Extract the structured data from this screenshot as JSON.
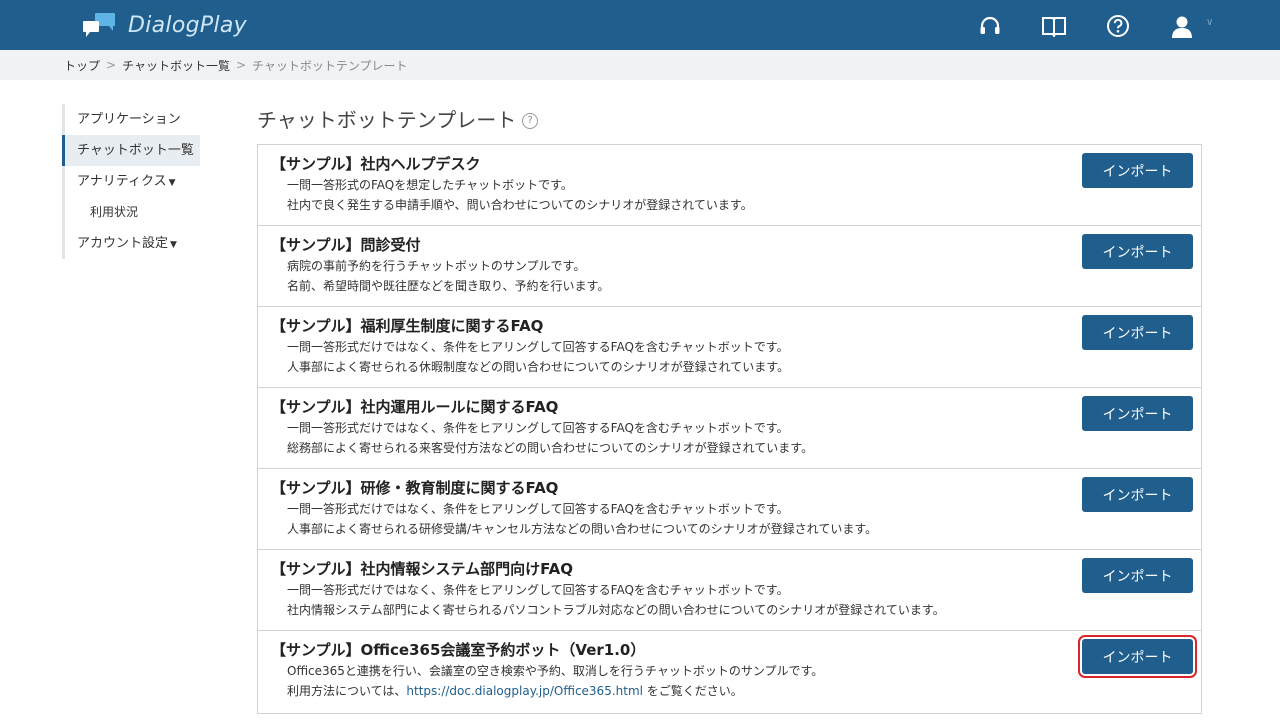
{
  "app": {
    "name": "DialogPlay"
  },
  "header_icons": [
    "headset-icon",
    "book-icon",
    "help-icon",
    "user-icon"
  ],
  "breadcrumb": {
    "home": "トップ",
    "list": "チャットボット一覧",
    "current": "チャットボットテンプレート",
    "separator": ">"
  },
  "sidebar": {
    "items": [
      {
        "label": "アプリケーション"
      },
      {
        "label": "チャットボット一覧"
      },
      {
        "label": "アナリティクス"
      },
      {
        "label": "利用状況"
      },
      {
        "label": "アカウント設定"
      }
    ]
  },
  "page": {
    "title": "チャットボットテンプレート",
    "help": "?"
  },
  "templates": [
    {
      "title": "【サンプル】社内ヘルプデスク",
      "desc1": "一問一答形式のFAQを想定したチャットボットです。",
      "desc2": "社内で良く発生する申請手順や、問い合わせについてのシナリオが登録されています。",
      "button": "インポート"
    },
    {
      "title": "【サンプル】問診受付",
      "desc1": "病院の事前予約を行うチャットボットのサンプルです。",
      "desc2": "名前、希望時間や既往歴などを聞き取り、予約を行います。",
      "button": "インポート"
    },
    {
      "title": "【サンプル】福利厚生制度に関するFAQ",
      "desc1": "一問一答形式だけではなく、条件をヒアリングして回答するFAQを含むチャットボットです。",
      "desc2": "人事部によく寄せられる休暇制度などの問い合わせについてのシナリオが登録されています。",
      "button": "インポート"
    },
    {
      "title": "【サンプル】社内運用ルールに関するFAQ",
      "desc1": "一問一答形式だけではなく、条件をヒアリングして回答するFAQを含むチャットボットです。",
      "desc2": "総務部によく寄せられる来客受付方法などの問い合わせについてのシナリオが登録されています。",
      "button": "インポート"
    },
    {
      "title": "【サンプル】研修・教育制度に関するFAQ",
      "desc1": "一問一答形式だけではなく、条件をヒアリングして回答するFAQを含むチャットボットです。",
      "desc2": "人事部によく寄せられる研修受講/キャンセル方法などの問い合わせについてのシナリオが登録されています。",
      "button": "インポート"
    },
    {
      "title": "【サンプル】社内情報システム部門向けFAQ",
      "desc1": "一問一答形式だけではなく、条件をヒアリングして回答するFAQを含むチャットボットです。",
      "desc2": "社内情報システム部門によく寄せられるパソコントラブル対応などの問い合わせについてのシナリオが登録されています。",
      "button": "インポート"
    },
    {
      "title": "【サンプル】Office365会議室予約ボット（Ver1.0）",
      "desc1": "Office365と連携を行い、会議室の空き検索や予約、取消しを行うチャットボットのサンプルです。",
      "desc2_prefix": "利用方法については、",
      "desc2_url": "https://doc.dialogplay.jp/Office365.html",
      "desc2_suffix": " をご覧ください。",
      "button": "インポート"
    }
  ],
  "colors": {
    "header": "#1f5e8d",
    "button": "#1f5e8d",
    "highlight": "#d9262a"
  }
}
